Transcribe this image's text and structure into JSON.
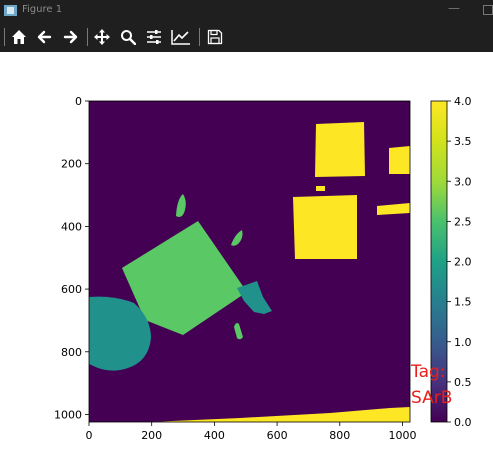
{
  "window": {
    "title": "Figure 1"
  },
  "toolbar": {
    "tools": [
      "home-icon",
      "back-icon",
      "forward-icon",
      "pan-icon",
      "zoom-icon",
      "configure-subplots-icon",
      "edit-axis-icon",
      "save-icon"
    ]
  },
  "chart_data": [
    {
      "type": "heatmap",
      "colormap": "viridis",
      "xlim": [
        0,
        1024
      ],
      "ylim": [
        1024,
        0
      ],
      "x_ticks": [
        "0",
        "200",
        "400",
        "600",
        "800",
        "1000"
      ],
      "y_ticks": [
        "0",
        "200",
        "400",
        "600",
        "800",
        "1000"
      ],
      "grid": false,
      "regions": [
        {
          "value": 0.0,
          "shape": "background"
        },
        {
          "value": 4.0,
          "shape": "square",
          "center": [
            755,
            120
          ]
        },
        {
          "value": 4.0,
          "shape": "square",
          "center": [
            745,
            375
          ]
        },
        {
          "value": 4.0,
          "shape": "rectangle",
          "center": [
            995,
            175
          ]
        },
        {
          "value": 4.0,
          "shape": "rectangle",
          "center": [
            965,
            330
          ]
        },
        {
          "value": 4.0,
          "shape": "band",
          "center": [
            700,
            1010
          ]
        },
        {
          "value": 3.0,
          "shape": "rotated square",
          "center": [
            325,
            550
          ]
        },
        {
          "value": 3.0,
          "shape": "blob",
          "center": [
            290,
            310
          ]
        },
        {
          "value": 3.0,
          "shape": "blob",
          "center": [
            470,
            430
          ]
        },
        {
          "value": 3.0,
          "shape": "blob",
          "center": [
            470,
            735
          ]
        },
        {
          "value": 2.5,
          "shape": "circle",
          "center": [
            100,
            775
          ]
        },
        {
          "value": 2.5,
          "shape": "blob",
          "center": [
            525,
            640
          ]
        }
      ],
      "colorbar": {
        "ticks": [
          "0.0",
          "0.5",
          "1.0",
          "1.5",
          "2.0",
          "2.5",
          "3.0",
          "3.5",
          "4.0"
        ],
        "range": [
          0,
          4
        ]
      }
    }
  ],
  "annotation": {
    "line1": "Tag:",
    "line2": "SArB",
    "color": "#e8201a"
  }
}
